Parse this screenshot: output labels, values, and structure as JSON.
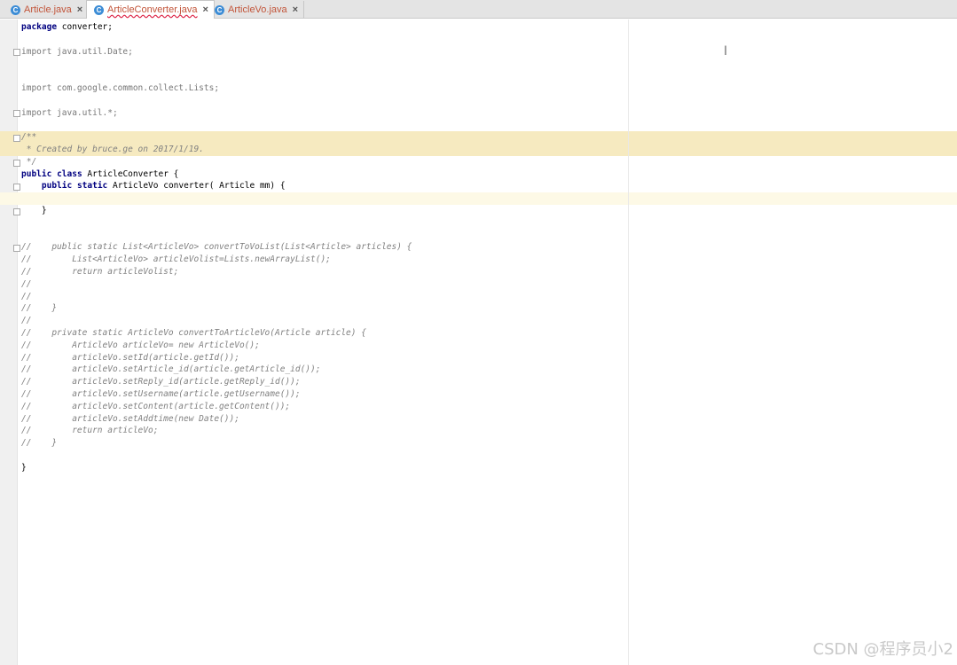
{
  "tabs": [
    {
      "label": "Article.java",
      "icon": "class-c-icon",
      "active": false
    },
    {
      "label": "ArticleConverter.java",
      "icon": "class-c-icon",
      "active": true
    },
    {
      "label": "ArticleVo.java",
      "icon": "class-c-icon",
      "active": false
    }
  ],
  "tab_close_glyph": "×",
  "class_icon_glyph": "C",
  "code_lines": [
    "package converter;",
    "",
    "import java.util.Date;",
    "",
    "",
    "import com.google.common.collect.Lists;",
    "",
    "import java.util.*;",
    "",
    "/**",
    " * Created by bruce.ge on 2017/1/19.",
    " */",
    "public class ArticleConverter {",
    "    public static ArticleVo converter( Article mm) {",
    "",
    "    }",
    "",
    "",
    "//    public static List<ArticleVo> convertToVoList(List<Article> articles) {",
    "//        List<ArticleVo> articleVolist=Lists.newArrayList();",
    "//        return articleVolist;",
    "//",
    "//",
    "//    }",
    "//",
    "//    private static ArticleVo convertToArticleVo(Article article) {",
    "//        ArticleVo articleVo= new ArticleVo();",
    "//        articleVo.setId(article.getId());",
    "//        articleVo.setArticle_id(article.getArticle_id());",
    "//        articleVo.setReply_id(article.getReply_id());",
    "//        articleVo.setUsername(article.getUsername());",
    "//        articleVo.setContent(article.getContent());",
    "//        articleVo.setAddtime(new Date());",
    "//        return articleVo;",
    "//    }",
    "",
    "}"
  ],
  "text_cursor_glyph": "I",
  "watermark": "CSDN @程序员小2",
  "colors": {
    "keyword": "#000080",
    "comment": "#808080",
    "doc_highlight": "#f6eac0",
    "caret_line": "#fdf9e6",
    "tab_text": "#c2553a",
    "class_icon": "#3d8dd6"
  }
}
